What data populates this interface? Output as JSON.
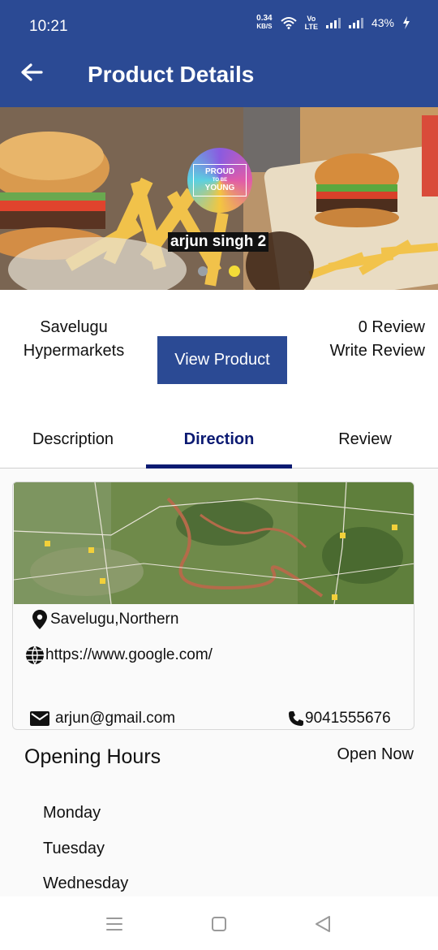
{
  "status_bar": {
    "time": "10:21",
    "speed_value": "0.34",
    "speed_unit": "KB/S",
    "network": "Vo\nLTE",
    "battery": "43%"
  },
  "app_bar": {
    "title": "Product Details",
    "back_icon": "arrow-left-icon"
  },
  "hero": {
    "badge_line1": "PROUD",
    "badge_line2": "TO BE",
    "badge_line3": "YOUNG",
    "caption": "arjun singh 2",
    "slide_count": 2,
    "active_slide": 2
  },
  "store": {
    "name": "Savelugu Hypermarkets",
    "view_button": "View Product",
    "review_count": "0 Review",
    "write_review": "Write Review"
  },
  "tabs": [
    {
      "label": "Description",
      "active": false
    },
    {
      "label": "Direction",
      "active": true
    },
    {
      "label": "Review",
      "active": false
    }
  ],
  "contact": {
    "location": "Savelugu,Northern",
    "website": "https://www.google.com/",
    "email": "arjun@gmail.com",
    "phone": "9041555676"
  },
  "hours": {
    "title": "Opening Hours",
    "status": "Open Now",
    "days": [
      "Monday",
      "Tuesday",
      "Wednesday"
    ]
  },
  "colors": {
    "primary": "#2b4a94",
    "tab_active": "#0b1a72",
    "dot_active": "#f3dc38"
  }
}
